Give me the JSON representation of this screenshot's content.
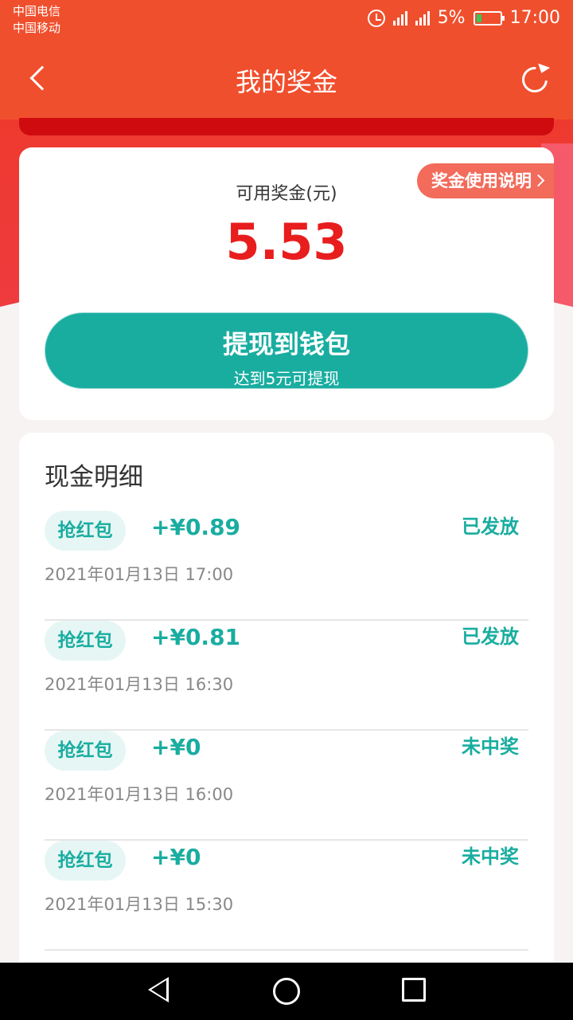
{
  "status_bar": {
    "carrier_1": "中国电信",
    "carrier_2": "中国移动",
    "network_1": "4G 2G",
    "network_2": "2G",
    "battery": "5%",
    "time": "17:00"
  },
  "header": {
    "title": "我的奖金",
    "back_icon": "chevron-left-icon",
    "refresh_icon": "refresh-icon"
  },
  "balance": {
    "help_label": "奖金使用说明",
    "label": "可用奖金(元)",
    "amount": "5.53",
    "withdraw_label": "提现到钱包",
    "withdraw_hint": "达到5元可提现"
  },
  "details": {
    "title": "现金明细",
    "records": [
      {
        "tag": "抢红包",
        "amount": "+¥0.89",
        "status": "已发放",
        "time": "2021年01月13日  17:00"
      },
      {
        "tag": "抢红包",
        "amount": "+¥0.81",
        "status": "已发放",
        "time": "2021年01月13日  16:30"
      },
      {
        "tag": "抢红包",
        "amount": "+¥0",
        "status": "未中奖",
        "time": "2021年01月13日  16:00"
      },
      {
        "tag": "抢红包",
        "amount": "+¥0",
        "status": "未中奖",
        "time": "2021年01月13日  15:30"
      }
    ]
  },
  "colors": {
    "header_red": "#f04f2d",
    "amount_red": "#e81d1d",
    "teal": "#19ada0"
  }
}
